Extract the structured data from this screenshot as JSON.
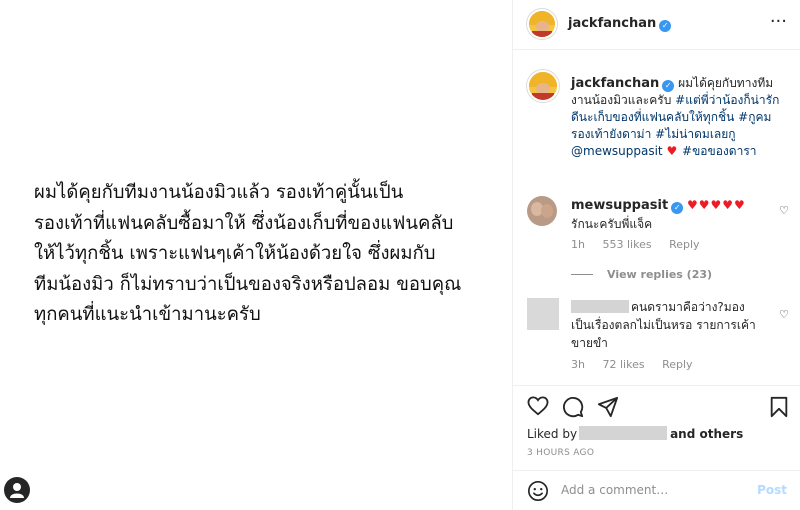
{
  "post": {
    "text": "ผมได้คุยกับทีมงานน้องมิวแล้ว รองเท้าคู่นั้นเป็น\nรองเท้าที่แฟนคลับซื้อมาให้ ซึ่งน้องเก็บที่ของแฟนคลับ\nให้ไว้ทุกชิ้น เพราะแฟนๆเค้าให้น้องด้วยใจ ซึ่งผมกับ\nทีมน้องมิว ก็ไม่ทราบว่าเป็นของจริงหรือปลอม ขอบคุณ\nทุกคนที่แนะนำเข้ามานะครับ"
  },
  "header": {
    "username": "jackfanchan",
    "verified_mark": "✓",
    "more_label": "···"
  },
  "caption": {
    "username": "jackfanchan",
    "text_part1": "ผมได้คุยกับทางทีมงานน้องมิวและครับ",
    "hashtag1": "#แต่พี่ว่าน้องก็น่ารักดีนะเก็บของที่แฟนคลับให้ทุกชิ้น",
    "hashtag2": "#กูคมรองเท้ายังดาม่า",
    "hashtag3": "#ไม่น่าดมเลยกู",
    "mention": "@mewsuppasit",
    "heart": "♥",
    "hashtag4": "#ขอของดารา"
  },
  "comments": [
    {
      "username": "mewsuppasit",
      "hearts": "♥♥♥♥♥",
      "text": "รักนะครับพี่แจ็ค",
      "time": "1h",
      "likes": "553 likes",
      "reply": "Reply"
    },
    {
      "text_line1": "คนดรามาคือว่าง?มอง",
      "text_rest": "เป็นเรื่องตลกไม่เป็นหรอ รายการเค้าขายขำ",
      "time": "3h",
      "likes": "72 likes",
      "reply": "Reply"
    }
  ],
  "view_replies": "View replies (23)",
  "actions": {
    "liked_by": "Liked by",
    "and_others": "and others",
    "time_ago": "3 HOURS AGO"
  },
  "add_comment": {
    "placeholder": "Add a comment…",
    "post_label": "Post"
  },
  "icons": {
    "like": "heart-icon",
    "comment": "comment-icon",
    "share": "share-icon",
    "save": "bookmark-icon",
    "emoji": "emoji-icon",
    "more": "more-icon",
    "profile": "user-icon"
  },
  "colors": {
    "link": "#00376b",
    "verified": "#3897f0",
    "heart": "#ed1c24",
    "muted": "#8e8e8e",
    "post_disabled": "#b3dbff"
  }
}
